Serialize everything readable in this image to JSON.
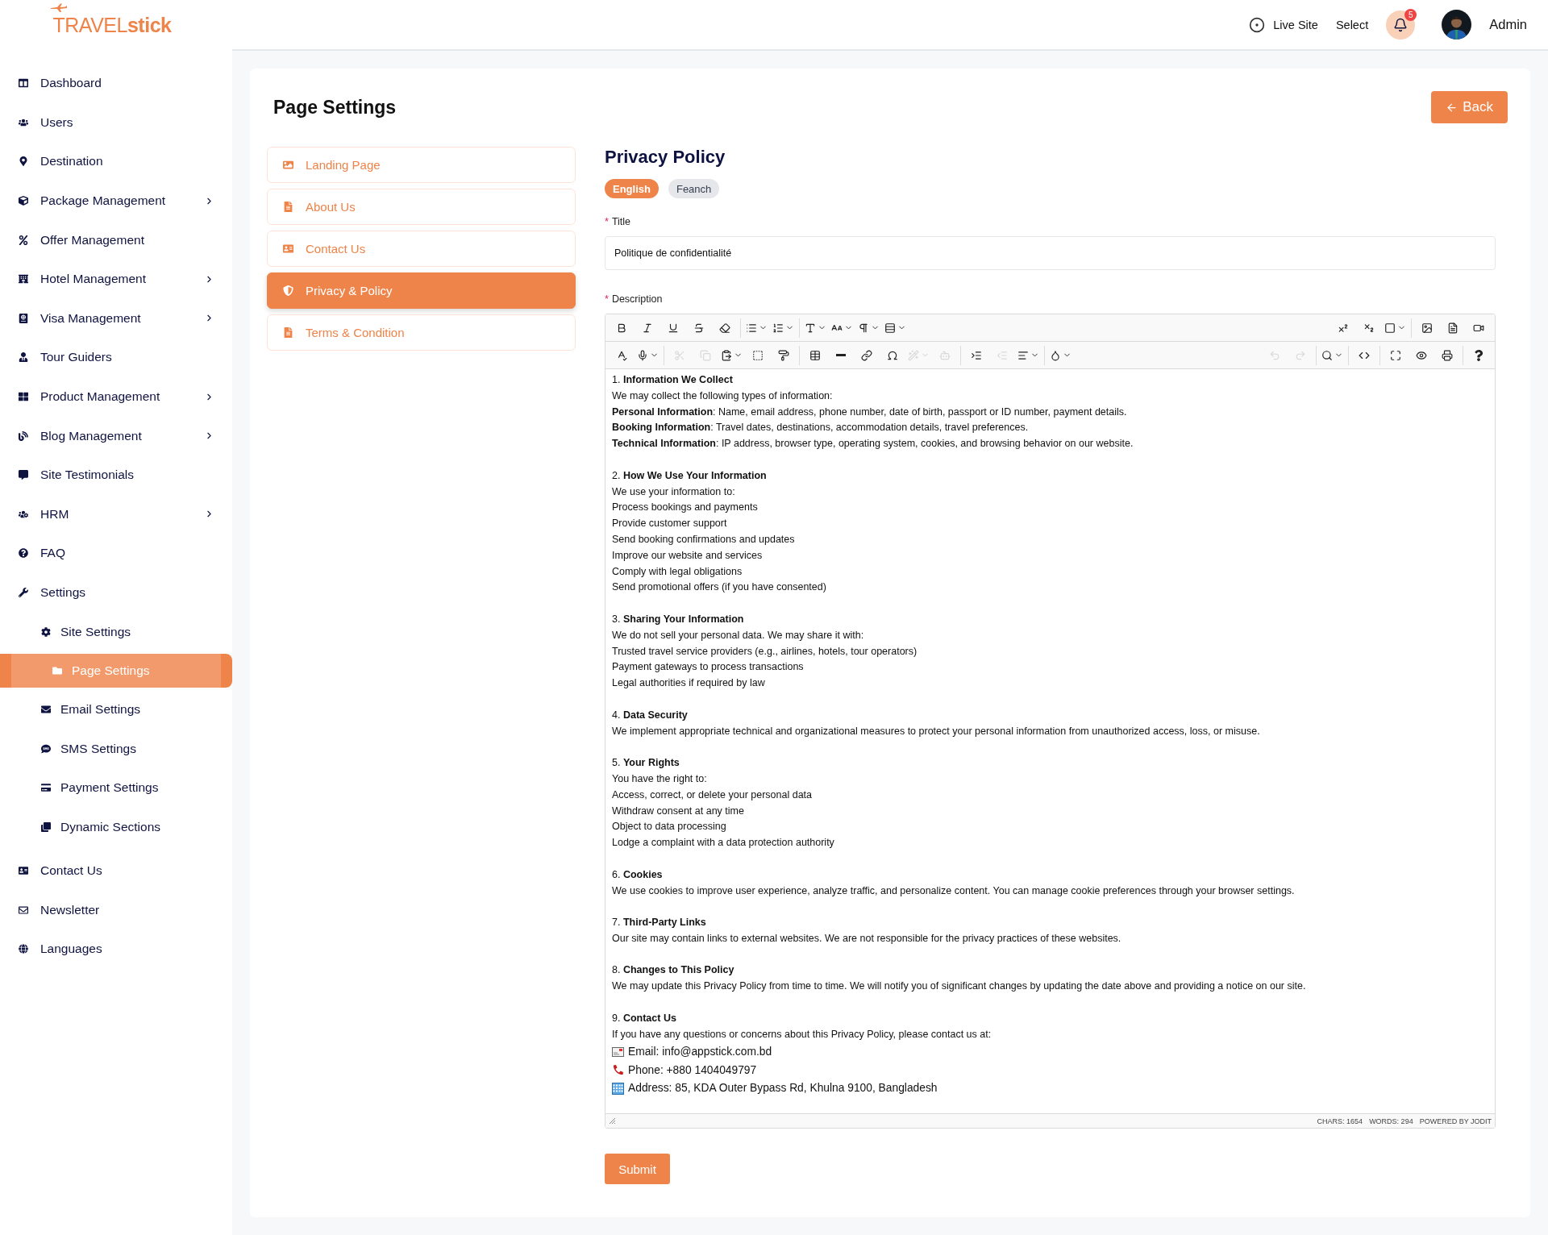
{
  "header": {
    "logo": "TRAVEL**stick**",
    "live_site": "Live Site",
    "select": "Select",
    "notifications": "5",
    "user": "Admin"
  },
  "sidebar": {
    "items": [
      {
        "label": "Dashboard",
        "expandable": false,
        "selected": false
      },
      {
        "label": "Users",
        "expandable": false,
        "selected": false
      },
      {
        "label": "Destination",
        "expandable": false,
        "selected": false
      },
      {
        "label": "Package Management",
        "expandable": true,
        "selected": false
      },
      {
        "label": "Offer Management",
        "expandable": false,
        "selected": false
      },
      {
        "label": "Hotel Management",
        "expandable": true,
        "selected": false
      },
      {
        "label": "Visa Management",
        "expandable": true,
        "selected": false
      },
      {
        "label": "Tour Guiders",
        "expandable": false,
        "selected": false
      },
      {
        "label": "Product Management",
        "expandable": true,
        "selected": false
      },
      {
        "label": "Blog Management",
        "expandable": true,
        "selected": false
      },
      {
        "label": "Site Testimonials",
        "expandable": false,
        "selected": false
      },
      {
        "label": "HRM",
        "expandable": true,
        "selected": false
      },
      {
        "label": "FAQ",
        "expandable": false,
        "selected": false
      },
      {
        "label": "Settings",
        "expandable": false,
        "selected": false,
        "children": [
          {
            "label": "Site Settings",
            "selected": false
          },
          {
            "label": "Page Settings",
            "selected": true
          },
          {
            "label": "Email Settings",
            "selected": false
          },
          {
            "label": "SMS Settings",
            "selected": false
          },
          {
            "label": "Payment Settings",
            "selected": false
          },
          {
            "label": "Dynamic Sections",
            "selected": false
          }
        ]
      },
      {
        "label": "Contact Us",
        "expandable": false,
        "selected": false
      },
      {
        "label": "Newsletter",
        "expandable": false,
        "selected": false
      },
      {
        "label": "Languages",
        "expandable": false,
        "selected": false
      }
    ]
  },
  "page": {
    "title": "Page Settings",
    "back": "Back"
  },
  "tabs": [
    {
      "label": "Landing Page",
      "selected": false
    },
    {
      "label": "About Us",
      "selected": false
    },
    {
      "label": "Contact Us",
      "selected": false
    },
    {
      "label": "Privacy & Policy",
      "selected": true
    },
    {
      "label": "Terms & Condition",
      "selected": false
    }
  ],
  "form": {
    "heading": "Privacy Policy",
    "languages": [
      {
        "label": "English",
        "selected": true
      },
      {
        "label": "Feanch",
        "selected": false
      }
    ],
    "title_field": {
      "mark": "*",
      "label": "Title",
      "value": "Politique de confidentialité"
    },
    "description_field": {
      "mark": "*",
      "label": "Description"
    },
    "toolbar": [
      {
        "disabled": false
      },
      {
        "disabled": false
      },
      {
        "disabled": false
      },
      {
        "disabled": false
      },
      {
        "disabled": false
      },
      {
        "disabled": false
      },
      {
        "disabled": false
      },
      {
        "disabled": false
      },
      {
        "disabled": false
      },
      {
        "disabled": false
      },
      {
        "disabled": false
      },
      {
        "disabled": false
      },
      {
        "disabled": false
      },
      {
        "disabled": false
      },
      {
        "disabled": false
      },
      {
        "disabled": false
      },
      {
        "disabled": false
      },
      {
        "disabled": false
      },
      {
        "disabled": false
      },
      {
        "disabled": true
      },
      {
        "disabled": true
      },
      {
        "disabled": false
      },
      {
        "disabled": false
      },
      {
        "disabled": false
      },
      {
        "disabled": false
      },
      {
        "disabled": false
      },
      {
        "disabled": false
      },
      {
        "disabled": false
      },
      {
        "disabled": true
      },
      {
        "disabled": true
      },
      {
        "disabled": false
      },
      {
        "disabled": true
      },
      {
        "disabled": false
      },
      {
        "disabled": false
      },
      {
        "disabled": true
      },
      {
        "disabled": true
      },
      {
        "disabled": false
      },
      {
        "disabled": false
      },
      {
        "disabled": false
      },
      {
        "disabled": false
      },
      {
        "disabled": false
      },
      {
        "disabled": false
      }
    ],
    "content": [
      {
        "heading": "1. **Information We Collect**",
        "lines": [
          "We may collect the following types of information:",
          "**Personal Information**: Name, email address, phone number, date of birth, passport or ID number, payment details.",
          "**Booking Information**: Travel dates, destinations, accommodation details, travel preferences.",
          "**Technical Information**: IP address, browser type, operating system, cookies, and browsing behavior on our website."
        ]
      },
      {
        "heading": "2. **How We Use Your Information**",
        "lines": [
          "We use your information to:",
          "Process bookings and payments",
          "Provide customer support",
          "Send booking confirmations and updates",
          "Improve our website and services",
          "Comply with legal obligations",
          "Send promotional offers (if you have consented)"
        ]
      },
      {
        "heading": "3. **Sharing Your Information**",
        "lines": [
          "We do not sell your personal data. We may share it with:",
          "Trusted travel service providers (e.g., airlines, hotels, tour operators)",
          "Payment gateways to process transactions",
          "Legal authorities if required by law"
        ]
      },
      {
        "heading": "4. **Data Security**",
        "lines": [
          "We implement appropriate technical and organizational measures to protect your personal information from unauthorized access, loss, or misuse."
        ]
      },
      {
        "heading": "5. **Your Rights**",
        "lines": [
          "You have the right to:",
          "Access, correct, or delete your personal data",
          "Withdraw consent at any time",
          "Object to data processing",
          "Lodge a complaint with a data protection authority"
        ]
      },
      {
        "heading": "6. **Cookies**",
        "lines": [
          "We use cookies to improve user experience, analyze traffic, and personalize content. You can manage cookie preferences through your browser settings."
        ]
      },
      {
        "heading": "7. **Third-Party Links**",
        "lines": [
          "Our site may contain links to external websites. We are not responsible for the privacy practices of these websites."
        ]
      },
      {
        "heading": "8. **Changes to This Policy**",
        "lines": [
          "We may update this Privacy Policy from time to time. We will notify you of significant changes by updating the date above and providing a notice on our site."
        ]
      },
      {
        "heading": "9. **Contact Us**",
        "lines": [
          "If you have any questions or concerns about this Privacy Policy, please contact us at:"
        ],
        "contacts": [
          {
            "kind": "email",
            "text": "Email: info@appstick.com.bd"
          },
          {
            "kind": "phone",
            "text": "Phone: +880 1404049797"
          },
          {
            "kind": "address",
            "text": "Address: 85, KDA Outer Bypass Rd, Khulna 9100, Bangladesh"
          }
        ]
      }
    ],
    "status": {
      "chars": "CHARS: 1654",
      "words": "WORDS: 294",
      "powered": "POWERED BY JODIT"
    },
    "submit": "Submit"
  }
}
